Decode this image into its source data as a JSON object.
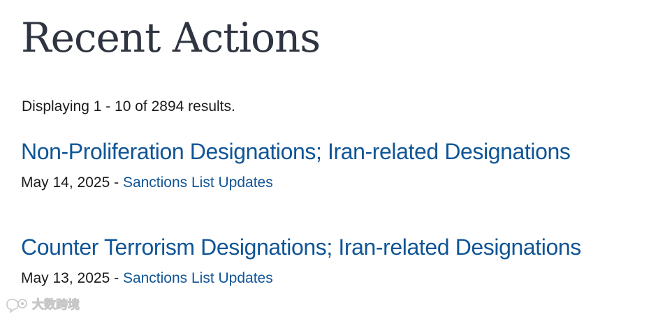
{
  "page": {
    "title": "Recent Actions",
    "result_summary": "Displaying 1 - 10 of 2894 results."
  },
  "actions": [
    {
      "title": "Non-Proliferation Designations; Iran-related Designations",
      "date": "May 14, 2025",
      "separator": " - ",
      "category": "Sanctions List Updates"
    },
    {
      "title": "Counter Terrorism Designations; Iran-related Designations",
      "date": "May 13, 2025",
      "separator": " - ",
      "category": "Sanctions List Updates"
    }
  ],
  "watermark": {
    "text": "大数跨境",
    "icon": "chat-bubble-logo-icon"
  },
  "colors": {
    "link": "#105596",
    "heading": "#2e3440",
    "body_text": "#1b1b1b",
    "background": "#ffffff"
  }
}
